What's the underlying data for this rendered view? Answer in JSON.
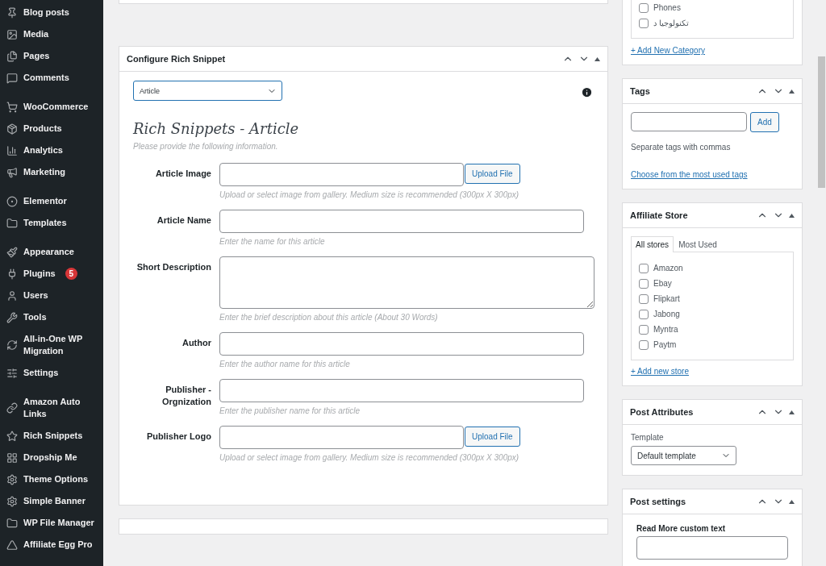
{
  "sidebar": {
    "groups": [
      {
        "items": [
          {
            "label": "Blog posts"
          },
          {
            "label": "Media"
          },
          {
            "label": "Pages"
          },
          {
            "label": "Comments"
          }
        ]
      },
      {
        "items": [
          {
            "label": "WooCommerce"
          },
          {
            "label": "Products"
          },
          {
            "label": "Analytics"
          },
          {
            "label": "Marketing"
          }
        ]
      },
      {
        "items": [
          {
            "label": "Elementor"
          },
          {
            "label": "Templates"
          }
        ]
      },
      {
        "items": [
          {
            "label": "Appearance"
          },
          {
            "label": "Plugins",
            "badge": "5"
          },
          {
            "label": "Users"
          },
          {
            "label": "Tools"
          },
          {
            "label": "All-in-One WP Migration"
          },
          {
            "label": "Settings"
          }
        ]
      },
      {
        "items": [
          {
            "label": "Amazon Auto Links"
          },
          {
            "label": "Rich Snippets"
          },
          {
            "label": "Dropship Me"
          },
          {
            "label": "Theme Options"
          },
          {
            "label": "Simple Banner"
          },
          {
            "label": "WP File Manager"
          },
          {
            "label": "Affiliate Egg Pro"
          }
        ]
      }
    ]
  },
  "snippet_box": {
    "title": "Configure Rich Snippet",
    "type_select": "Article",
    "heading": "Rich Snippets - Article",
    "intro": "Please provide the following information.",
    "fields": [
      {
        "kind": "upload",
        "label": "Article Image",
        "button": "Upload File",
        "help": "Upload or select image from gallery. Medium size is recommended (300px X 300px)"
      },
      {
        "kind": "text",
        "label": "Article Name",
        "help": "Enter the name for this article"
      },
      {
        "kind": "textarea",
        "label": "Short Description",
        "help": "Enter the brief description about this article (About 30 Words)"
      },
      {
        "kind": "text",
        "label": "Author",
        "help": "Enter the author name for this article"
      },
      {
        "kind": "text",
        "label": "Publisher - Orgnization",
        "help": "Enter the publisher name for this article"
      },
      {
        "kind": "upload",
        "label": "Publisher Logo",
        "button": "Upload File",
        "help": "Upload or select image from gallery. Medium size is recommended (300px X 300px)"
      }
    ]
  },
  "categories": {
    "items": [
      {
        "label": "Phones",
        "checked": false
      },
      {
        "label": "تكنولوجيا د",
        "checked": false
      }
    ],
    "add_link": "+ Add New Category"
  },
  "tags": {
    "title": "Tags",
    "button": "Add",
    "hint": "Separate tags with commas",
    "link": "Choose from the most used tags"
  },
  "affiliate_store": {
    "title": "Affiliate Store",
    "tabs": [
      {
        "label": "All stores",
        "selected": true
      },
      {
        "label": "Most Used",
        "selected": false
      }
    ],
    "items": [
      {
        "label": "Amazon",
        "checked": false
      },
      {
        "label": "Ebay",
        "checked": false
      },
      {
        "label": "Flipkart",
        "checked": false
      },
      {
        "label": "Jabong",
        "checked": false
      },
      {
        "label": "Myntra",
        "checked": false
      },
      {
        "label": "Paytm",
        "checked": false
      }
    ],
    "add_link": "+ Add new store"
  },
  "post_attributes": {
    "title": "Post Attributes",
    "template_label": "Template",
    "template_value": "Default template"
  },
  "post_settings": {
    "title": "Post settings",
    "field_label": "Read More custom text"
  }
}
